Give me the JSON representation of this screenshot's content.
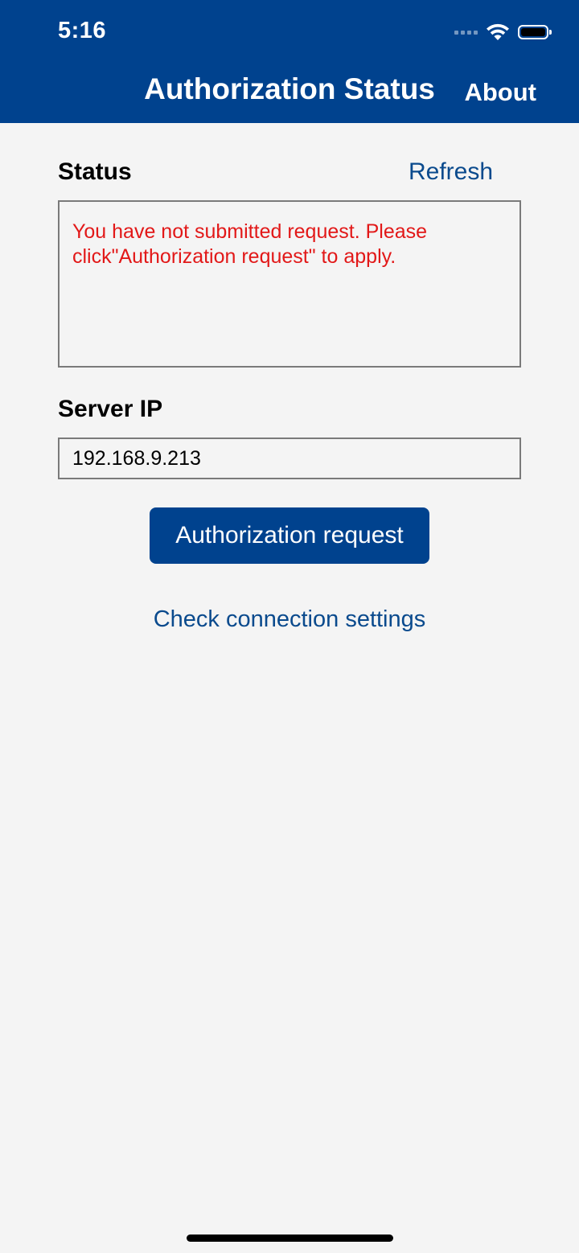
{
  "status_bar": {
    "time": "5:16",
    "icons": [
      "signal-icon",
      "wifi-icon",
      "battery-icon"
    ]
  },
  "nav": {
    "title": "Authorization Status",
    "about_label": "About"
  },
  "status_section": {
    "label": "Status",
    "refresh_label": "Refresh",
    "message": "You have not submitted request. Please click\"Authorization request\" to apply."
  },
  "server_section": {
    "label": "Server IP",
    "ip_value": "192.168.9.213"
  },
  "actions": {
    "authorization_request_label": "Authorization request",
    "check_connection_label": "Check connection settings"
  },
  "colors": {
    "header_bg": "#00428e",
    "link": "#0a4a8d",
    "error_text": "#e21818",
    "background": "#f4f4f4"
  }
}
